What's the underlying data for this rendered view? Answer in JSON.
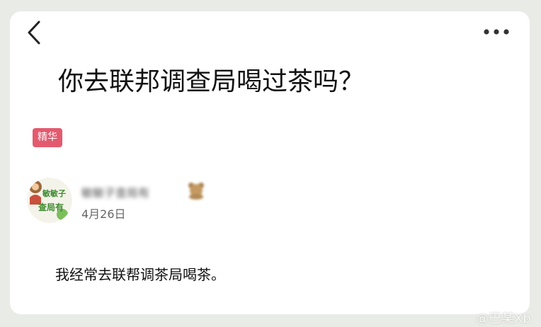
{
  "post": {
    "title": "你去联邦调查局喝过茶吗？",
    "badge": "精华",
    "author": {
      "name": "敏敏子查局有",
      "avatar_text": "敏敏子 查局有"
    },
    "date": "4月26日",
    "body": "我经常去联帮调茶局喝茶。"
  },
  "icons": {
    "back": "chevron-left-icon",
    "more": "more-dots-icon",
    "author_badge": "bear-icon"
  },
  "watermark": "@巴某Xb",
  "colors": {
    "badge_background": "#e35a6f",
    "card_background": "#ffffff",
    "page_background": "#e9ebe6"
  }
}
